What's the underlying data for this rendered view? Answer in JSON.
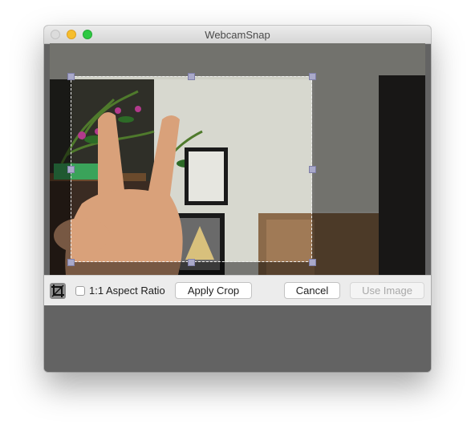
{
  "window": {
    "title": "WebcamSnap"
  },
  "toolbar": {
    "aspect_label": "1:1 Aspect Ratio",
    "aspect_checked": false,
    "apply_label": "Apply Crop",
    "cancel_label": "Cancel",
    "use_label": "Use Image",
    "use_enabled": false
  },
  "icons": {
    "close": "close-icon",
    "minimize": "minimize-icon",
    "zoom": "zoom-icon",
    "crop": "crop-icon"
  }
}
